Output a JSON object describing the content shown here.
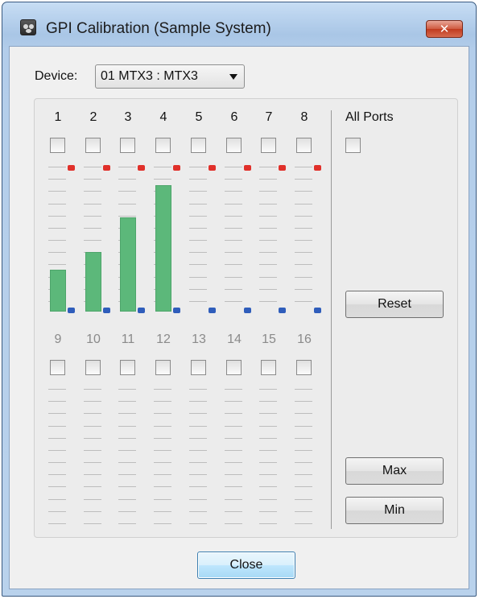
{
  "window": {
    "title": "GPI Calibration (Sample System)",
    "close_glyph": "✕"
  },
  "device": {
    "label": "Device:",
    "value": "01 MTX3 : MTX3"
  },
  "channels": [
    {
      "num": "1",
      "level": 0.3,
      "enabled": true
    },
    {
      "num": "2",
      "level": 0.43,
      "enabled": true
    },
    {
      "num": "3",
      "level": 0.68,
      "enabled": true
    },
    {
      "num": "4",
      "level": 0.91,
      "enabled": true
    },
    {
      "num": "5",
      "level": 0,
      "enabled": true
    },
    {
      "num": "6",
      "level": 0,
      "enabled": true
    },
    {
      "num": "7",
      "level": 0,
      "enabled": true
    },
    {
      "num": "8",
      "level": 0,
      "enabled": true
    },
    {
      "num": "9",
      "level": 0,
      "enabled": false
    },
    {
      "num": "10",
      "level": 0,
      "enabled": false
    },
    {
      "num": "11",
      "level": 0,
      "enabled": false
    },
    {
      "num": "12",
      "level": 0,
      "enabled": false
    },
    {
      "num": "13",
      "level": 0,
      "enabled": false
    },
    {
      "num": "14",
      "level": 0,
      "enabled": false
    },
    {
      "num": "15",
      "level": 0,
      "enabled": false
    },
    {
      "num": "16",
      "level": 0,
      "enabled": false
    }
  ],
  "all_ports": {
    "label": "All Ports"
  },
  "buttons": {
    "reset": "Reset",
    "max": "Max",
    "min": "Min",
    "close": "Close"
  },
  "colors": {
    "bar": "#5cb87a",
    "upper_marker": "#e0302a",
    "lower_marker": "#2f5dbb",
    "disabled_text": "#8a8a8a"
  }
}
